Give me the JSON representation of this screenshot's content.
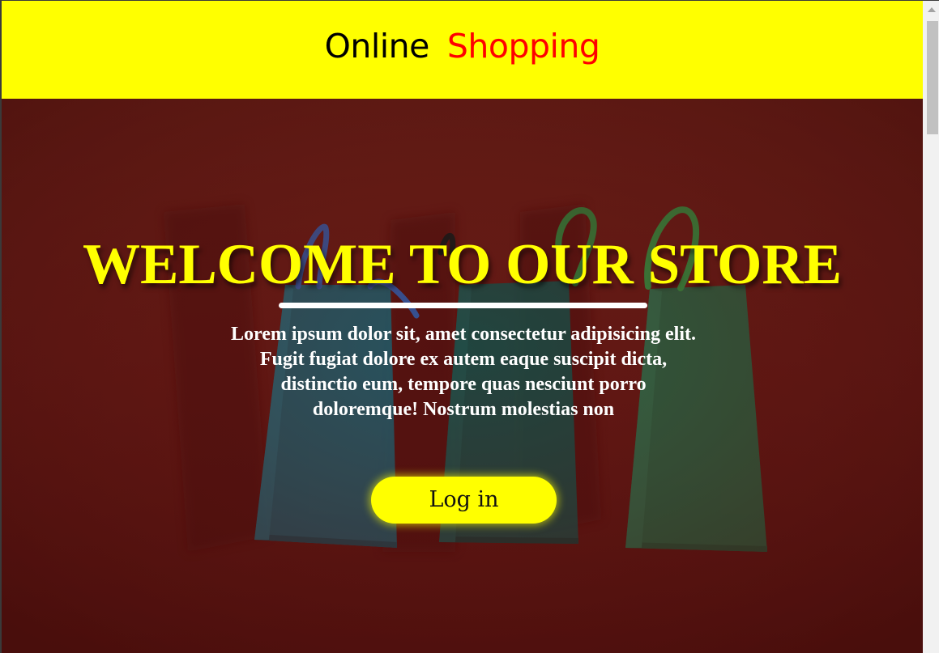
{
  "header": {
    "brand_online": "Online",
    "brand_shopping": "Shopping"
  },
  "hero": {
    "title": "WELCOME TO OUR STORE",
    "body": "Lorem ipsum dolor sit, amet consectetur adipisicing elit. Fugit fugiat dolore ex autem eaque suscipit dicta, distinctio eum, tempore quas nesciunt porro doloremque! Nostrum molestias non",
    "login_label": "Log in",
    "background_image": "shopping-bags-photo"
  },
  "colors": {
    "header_bg": "#ffff00",
    "brand_online": "#000000",
    "brand_shopping": "#ff0000",
    "hero_overlay": "#621814",
    "title": "#ffff00",
    "body_text": "#ffffff",
    "button_bg": "#ffff00"
  },
  "scrollbar": {
    "up_arrow_icon": "chevron-up-icon"
  }
}
